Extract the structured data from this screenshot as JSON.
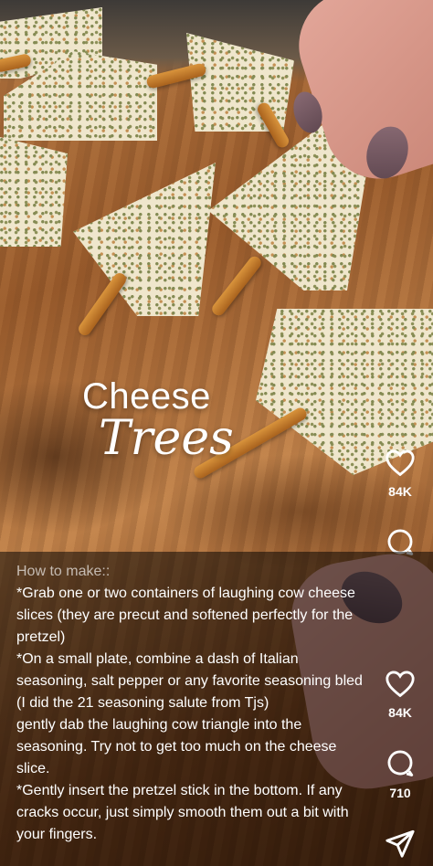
{
  "video": {
    "title_line1": "Cheese",
    "title_line2": "Trees"
  },
  "actions_upper": {
    "like_count": "84K"
  },
  "actions_lower": {
    "like_count": "84K",
    "comment_count": "710"
  },
  "caption": {
    "heading": "How to make::",
    "paragraphs": [
      "*Grab one or two containers of  laughing cow cheese slices (they are precut and softened perfectly for the pretzel)",
      "*On a small plate, combine a dash of Italian seasoning, salt pepper  or any favorite seasoning bled (I did the 21 seasoning salute from Tjs)",
      "gently dab the laughing cow triangle into the seasoning. Try not to get too much on the cheese slice.",
      "*Gently insert the pretzel stick  in the bottom. If any cracks occur, just simply smooth them out a bit with your fingers."
    ]
  },
  "colors": {
    "overlay": "#000000",
    "text": "#ffffff"
  },
  "icons": [
    "heart-icon",
    "comment-icon",
    "share-icon"
  ]
}
